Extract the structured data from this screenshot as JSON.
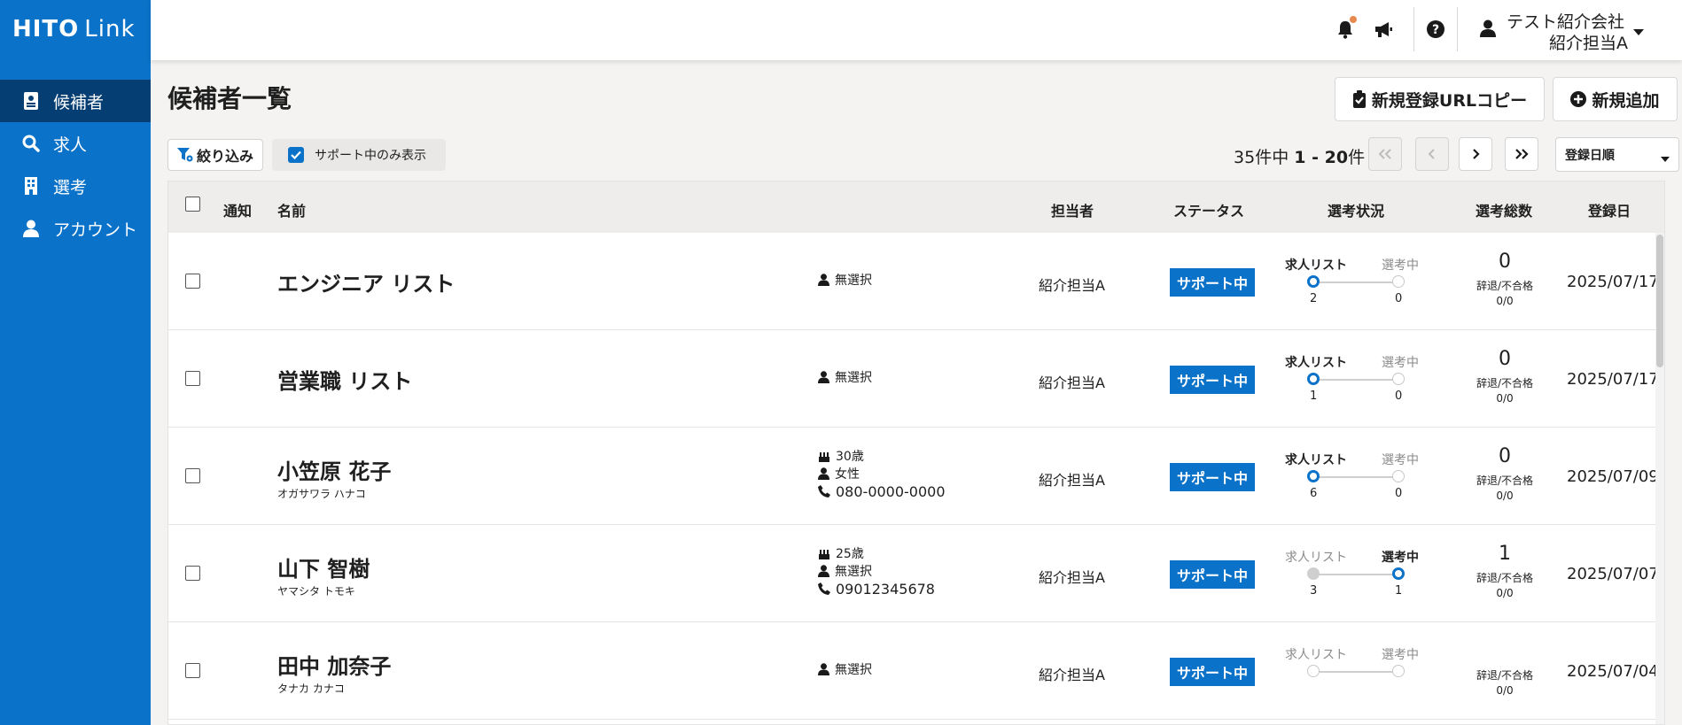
{
  "app": {
    "logo_bold": "HITO",
    "logo_light": "Link"
  },
  "sidebar": {
    "items": [
      {
        "label": "候補者",
        "icon": "id-card-icon",
        "active": true
      },
      {
        "label": "求人",
        "icon": "search-icon",
        "active": false
      },
      {
        "label": "選考",
        "icon": "building-icon",
        "active": false
      },
      {
        "label": "アカウント",
        "icon": "user-icon",
        "active": false
      }
    ]
  },
  "header": {
    "user_company": "テスト紹介会社",
    "user_name": "紹介担当A"
  },
  "page": {
    "title": "候補者一覧",
    "copy_url_button": "新規登録URLコピー",
    "add_button": "新規追加",
    "filter_button": "絞り込み",
    "support_only_label": "サポート中のみ表示",
    "support_only_checked": true,
    "pager_total": "35",
    "pager_mid": "件中",
    "pager_from": "1",
    "pager_dash": " - ",
    "pager_to": "20",
    "pager_suffix": "件",
    "sort_selected": "登録日順"
  },
  "table": {
    "headers": {
      "notify": "通知",
      "name": "名前",
      "assignee": "担当者",
      "status": "ステータス",
      "progress": "選考状況",
      "total": "選考総数",
      "registered": "登録日"
    },
    "rows": [
      {
        "name": "エンジニア リスト",
        "kana": "",
        "age": "",
        "gender": "無選択",
        "phone": "",
        "assignee": "紹介担当A",
        "status": "サポート中",
        "stage1_label": "求人リスト",
        "stage1_count": "2",
        "stage2_label": "選考中",
        "stage2_count": "0",
        "active_stage": 1,
        "total": "0",
        "withdraw_label": "辞退/不合格",
        "withdraw_value": "0/0",
        "date": "2025/07/17"
      },
      {
        "name": "営業職 リスト",
        "kana": "",
        "age": "",
        "gender": "無選択",
        "phone": "",
        "assignee": "紹介担当A",
        "status": "サポート中",
        "stage1_label": "求人リスト",
        "stage1_count": "1",
        "stage2_label": "選考中",
        "stage2_count": "0",
        "active_stage": 1,
        "total": "0",
        "withdraw_label": "辞退/不合格",
        "withdraw_value": "0/0",
        "date": "2025/07/17"
      },
      {
        "name": "小笠原 花子",
        "kana": "オガサワラ ハナコ",
        "age": "30歳",
        "gender": "女性",
        "phone": "080-0000-0000",
        "assignee": "紹介担当A",
        "status": "サポート中",
        "stage1_label": "求人リスト",
        "stage1_count": "6",
        "stage2_label": "選考中",
        "stage2_count": "0",
        "active_stage": 1,
        "total": "0",
        "withdraw_label": "辞退/不合格",
        "withdraw_value": "0/0",
        "date": "2025/07/09"
      },
      {
        "name": "山下 智樹",
        "kana": "ヤマシタ トモキ",
        "age": "25歳",
        "gender": "無選択",
        "phone": "09012345678",
        "assignee": "紹介担当A",
        "status": "サポート中",
        "stage1_label": "求人リスト",
        "stage1_count": "3",
        "stage2_label": "選考中",
        "stage2_count": "1",
        "active_stage": 2,
        "total": "1",
        "withdraw_label": "辞退/不合格",
        "withdraw_value": "0/0",
        "date": "2025/07/07"
      },
      {
        "name": "田中 加奈子",
        "kana": "タナカ カナコ",
        "age": "",
        "gender": "無選択",
        "phone": "",
        "assignee": "紹介担当A",
        "status": "サポート中",
        "stage1_label": "求人リスト",
        "stage1_count": "",
        "stage2_label": "選考中",
        "stage2_count": "",
        "active_stage": 0,
        "total": "",
        "withdraw_label": "辞退/不合格",
        "withdraw_value": "0/0",
        "date": "2025/07/04"
      }
    ]
  },
  "colors": {
    "primary": "#0a72c8",
    "sidebar_active": "#053e72",
    "notification_dot": "#e8894f"
  }
}
